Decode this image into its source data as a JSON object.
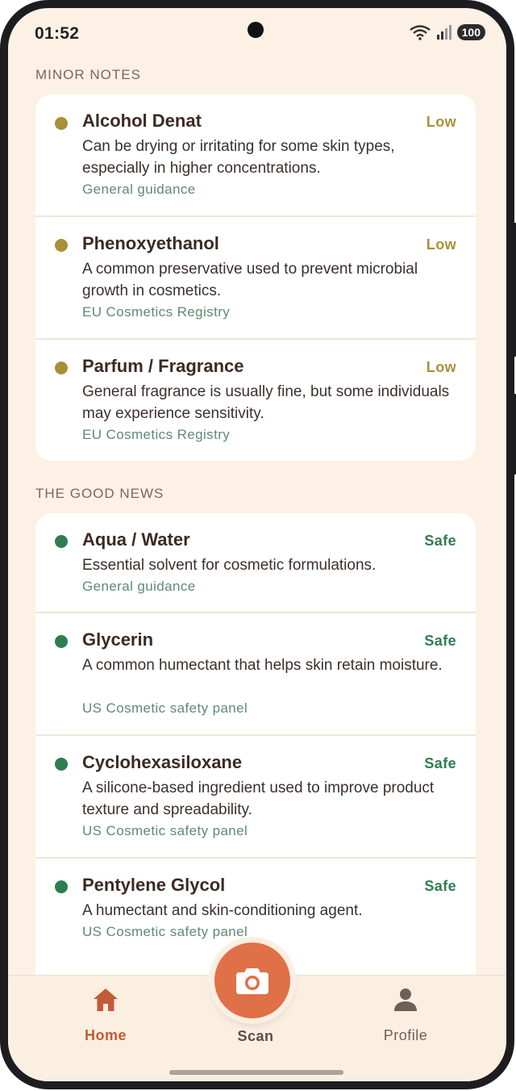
{
  "status_bar": {
    "time": "01:52",
    "battery": "100"
  },
  "sections": [
    {
      "title": "MINOR NOTES",
      "items": [
        {
          "name": "Alcohol Denat",
          "level": "Low",
          "description": "Can be drying or irritating for some skin types, especially in higher concentrations.",
          "source": "General guidance"
        },
        {
          "name": "Phenoxyethanol",
          "level": "Low",
          "description": "A common preservative used to prevent microbial growth in cosmetics.",
          "source": "EU Cosmetics Registry"
        },
        {
          "name": "Parfum / Fragrance",
          "level": "Low",
          "description": "General fragrance is usually fine, but some individuals may experience sensitivity.",
          "source": "EU Cosmetics Registry"
        }
      ]
    },
    {
      "title": "THE GOOD NEWS",
      "items": [
        {
          "name": "Aqua / Water",
          "level": "Safe",
          "description": "Essential solvent for cosmetic formulations.",
          "source": "General guidance"
        },
        {
          "name": "Glycerin",
          "level": "Safe",
          "description": "A common humectant that helps skin retain moisture.",
          "source": "US Cosmetic safety panel"
        },
        {
          "name": "Cyclohexasiloxane",
          "level": "Safe",
          "description": "A silicone-based ingredient used to improve product texture and spreadability.",
          "source": "US Cosmetic safety panel"
        },
        {
          "name": "Pentylene Glycol",
          "level": "Safe",
          "description": "A humectant and skin-conditioning agent.",
          "source": "US Cosmetic safety panel"
        }
      ]
    }
  ],
  "nav": {
    "home": "Home",
    "scan": "Scan",
    "profile": "Profile"
  },
  "colors": {
    "background": "#fcf1e4",
    "accent": "#e07048",
    "low": "#a8903a",
    "safe": "#2e7d50",
    "source": "#5e8a72"
  },
  "icons": {
    "home": "home-icon",
    "scan": "camera-icon",
    "profile": "person-icon"
  }
}
